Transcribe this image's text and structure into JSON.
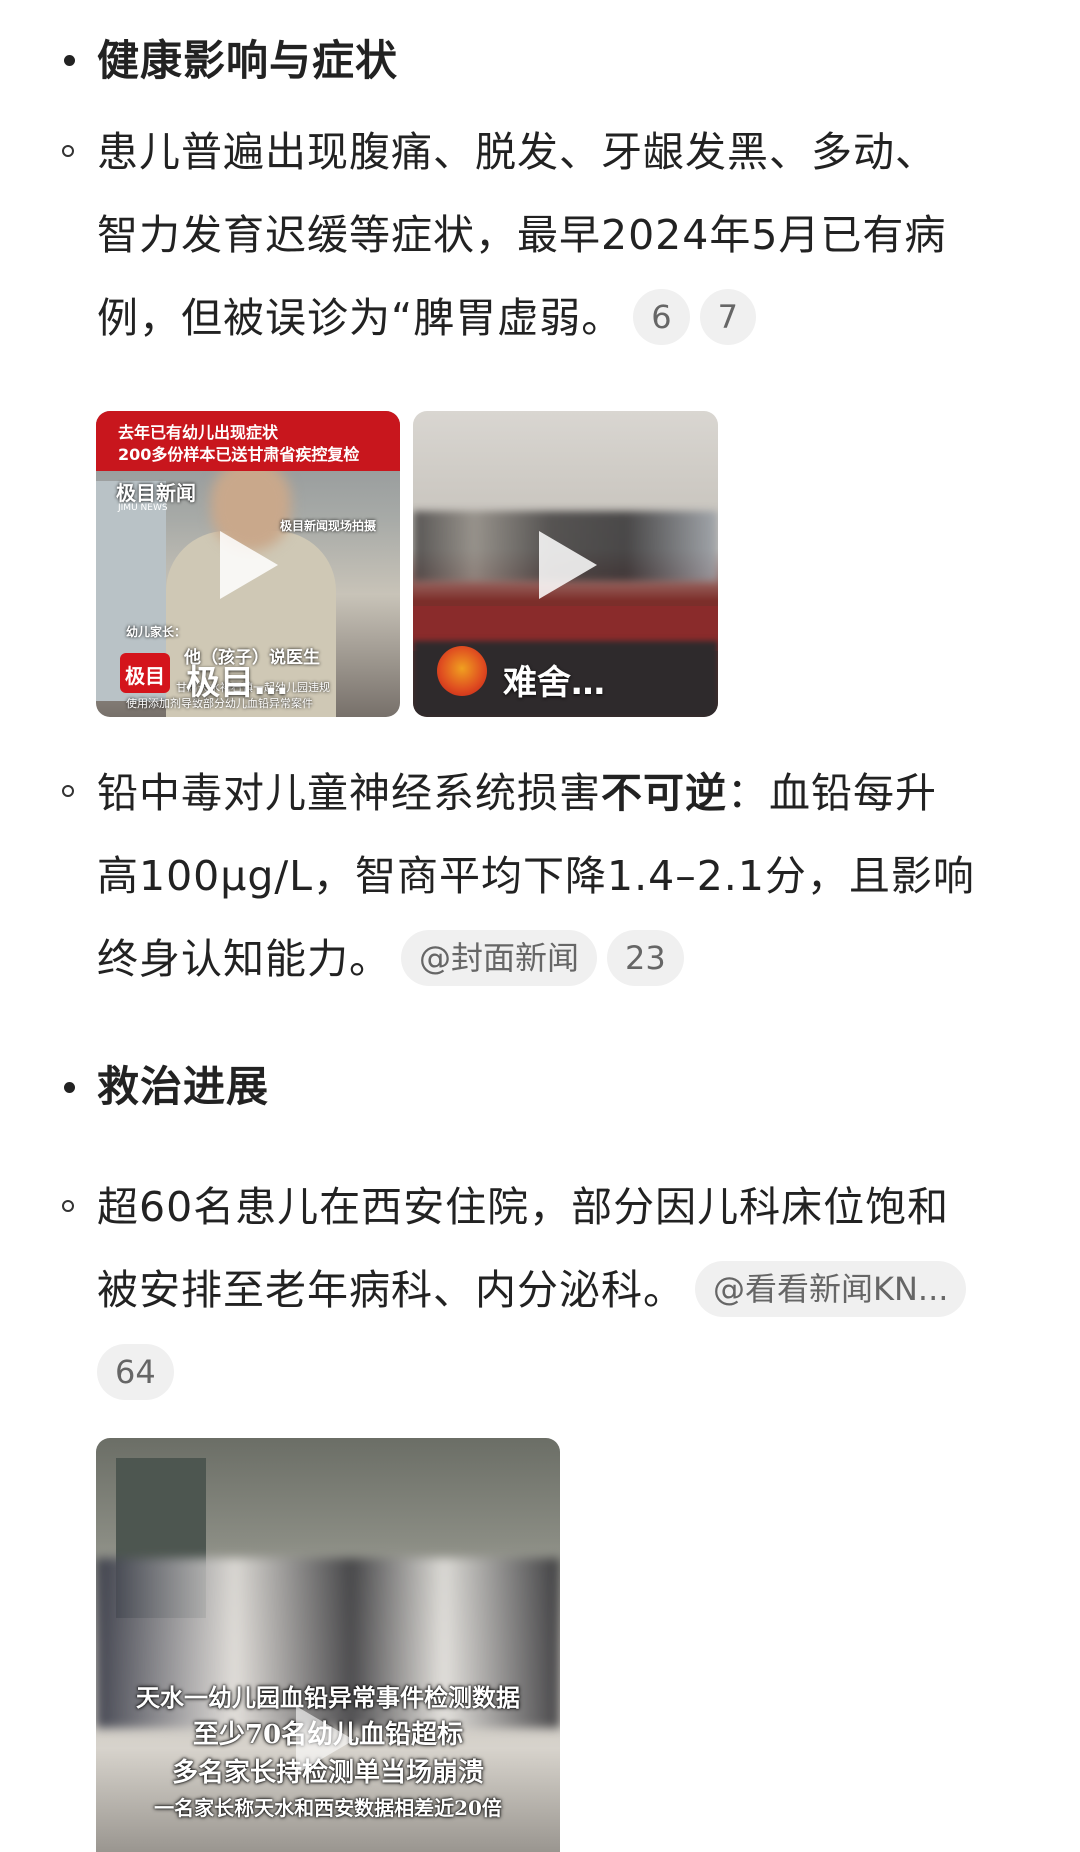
{
  "sections": [
    {
      "heading": "健康影响与症状",
      "items": [
        {
          "lines": [
            "患儿普遍出现腹痛、脱发、牙龈发黑、多动、",
            "智力发育迟缓等症状，最早2024年5月已有病",
            "例，但被误诊为“脾胃虚弱。"
          ],
          "chips": [
            "6",
            "7"
          ]
        },
        {
          "line1_pre": "铅中毒对儿童神经系统损害",
          "line1_bold": "不可逆",
          "line1_post": "：血铅每升",
          "line2": "高100μg/L，智商平均下降1.4–2.1分，且影响",
          "line3": "终身认知能力。",
          "chips": [
            "@封面新闻",
            "23"
          ]
        }
      ]
    },
    {
      "heading": "救治进展",
      "items": [
        {
          "lines": [
            "超60名患儿在西安住院，部分因儿科床位饱和",
            "被安排至老年病科、内分泌科。"
          ],
          "chips": [
            "@看看新闻KN...",
            "64"
          ]
        }
      ]
    }
  ],
  "videos": {
    "v1": {
      "banner_line1": "去年已有幼儿出现症状",
      "banner_line2": "200多份样本已送甘肃省疾控复检",
      "watermark": "极目新闻",
      "watermark_sub": "JIMU NEWS",
      "scene_note": "极目新闻现场拍摄",
      "speaker_label": "幼儿家长：",
      "subtitle": "他（孩子）说医生",
      "bottom_text1": "甘肃天水褐石镇一起幼儿园违规",
      "bottom_text2": "使用添加剂导致部分幼儿血铅异常案件",
      "logo_text": "极目",
      "source_name": "极目…"
    },
    "v2": {
      "source_name": "难舍…"
    },
    "v3": {
      "line1": "天水一幼儿园血铅异常事件检测数据",
      "line2": "至少70名幼儿血铅超标",
      "line3": "多名家长持检测单当场崩溃",
      "line4": "一名家长称天水和西安数据相差近20倍"
    }
  },
  "colors": {
    "text": "#222222",
    "chip_bg": "#f0f0f0",
    "chip_text": "#666666",
    "banner_red": "#c8161d"
  }
}
